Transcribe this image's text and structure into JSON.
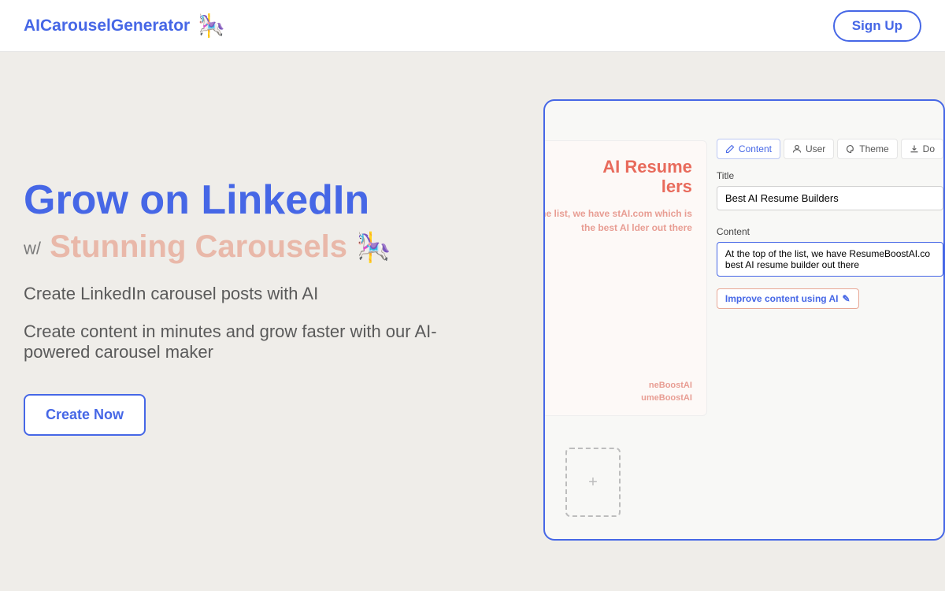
{
  "header": {
    "brand": "AICarouselGenerator",
    "brand_icon": "🎠",
    "signup": "Sign Up"
  },
  "hero": {
    "title": "Grow on LinkedIn",
    "subtitle_prefix": "w/",
    "subtitle": "Stunning Carousels",
    "subtitle_emoji": "🎠",
    "desc1": "Create LinkedIn carousel posts with AI",
    "desc2": "Create content in minutes and grow faster with our AI-powered carousel maker",
    "cta": "Create Now"
  },
  "editor": {
    "tabs": [
      {
        "icon": "pencil",
        "label": "Content",
        "active": true
      },
      {
        "icon": "user",
        "label": "User",
        "active": false
      },
      {
        "icon": "palette",
        "label": "Theme",
        "active": false
      },
      {
        "icon": "download",
        "label": "Do",
        "active": false
      }
    ],
    "title_label": "Title",
    "title_value": "Best AI Resume Builders",
    "content_label": "Content",
    "content_value": "At the top of the list, we have ResumeBoostAI.co best AI resume builder out there",
    "improve_label": "Improve content using AI",
    "improve_icon": "✎"
  },
  "card": {
    "title_line1": "AI Resume",
    "title_line2": "lers",
    "body": "f the list, we have stAI.com which is the best AI lder out there",
    "footer1": "neBoostAI",
    "footer2": "umeBoostAI"
  }
}
